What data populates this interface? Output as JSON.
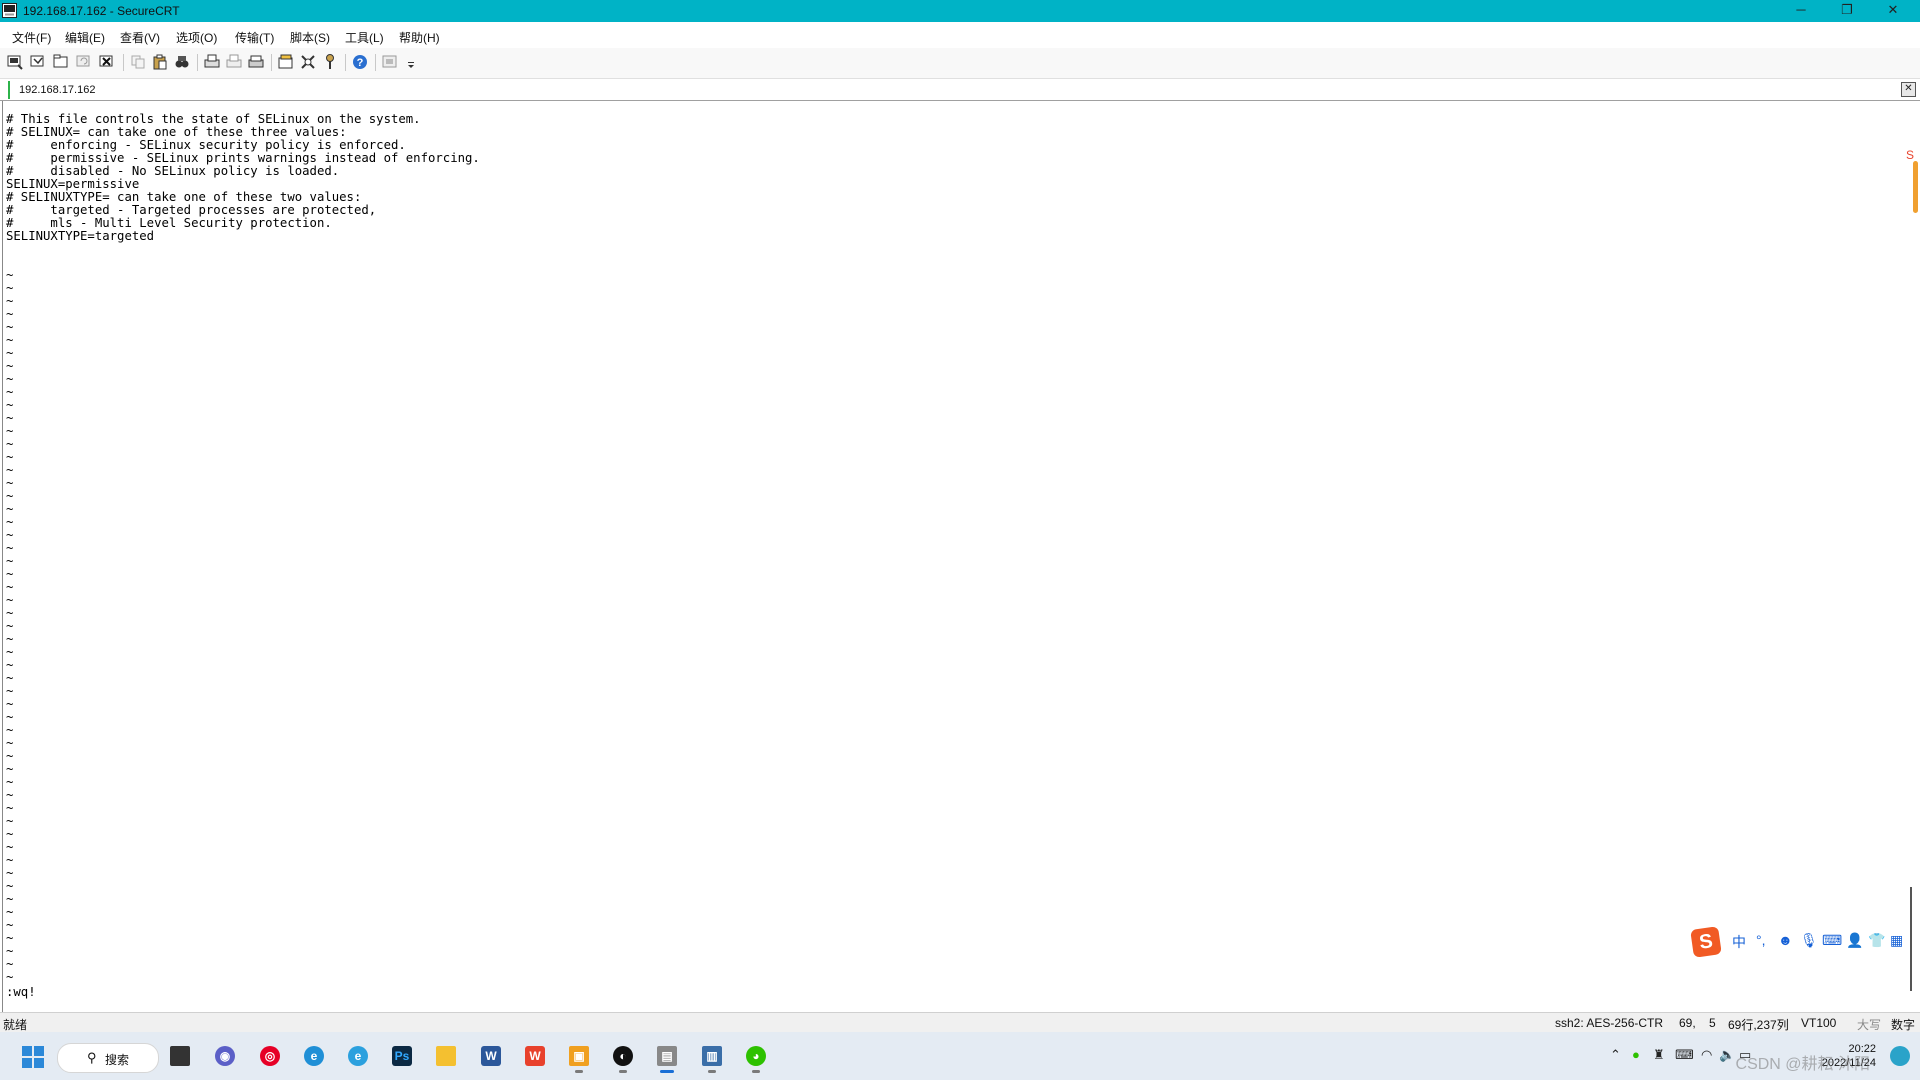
{
  "window": {
    "title": "192.168.17.162 - SecureCRT"
  },
  "menu": [
    "文件(F)",
    "编辑(E)",
    "查看(V)",
    "选项(O)",
    "传输(T)",
    "脚本(S)",
    "工具(L)",
    "帮助(H)"
  ],
  "tab": {
    "label": "192.168.17.162"
  },
  "terminal": {
    "lines": [
      "# This file controls the state of SELinux on the system.",
      "# SELINUX= can take one of these three values:",
      "#     enforcing - SELinux security policy is enforced.",
      "#     permissive - SELinux prints warnings instead of enforcing.",
      "#     disabled - No SELinux policy is loaded.",
      "SELINUX=permissive",
      "# SELINUXTYPE= can take one of these two values:",
      "#     targeted - Targeted processes are protected,",
      "#     mls - Multi Level Security protection.",
      "SELINUXTYPE=targeted"
    ],
    "tilde": "~",
    "tilde_count": 55,
    "command": ":wq!"
  },
  "status": {
    "ready": "就绪",
    "ssh": "ssh2: AES-256-CTR",
    "row": "69,",
    "col": "5",
    "size": "69行,237列",
    "term": "VT100",
    "caps": "大写",
    "num": "数字"
  },
  "ime": {
    "logo": "S",
    "chinese": "中"
  },
  "taskbar": {
    "search_label": "搜索"
  },
  "clock": {
    "time": "20:22",
    "date": "2022/11/24"
  },
  "watermark": "CSDN @耕耘 沐阳",
  "colors": {
    "titlebar": "#00b3c6",
    "tab_accent": "#2db34a",
    "taskbar": "#e4ebf3",
    "ime": "#f15a24"
  }
}
